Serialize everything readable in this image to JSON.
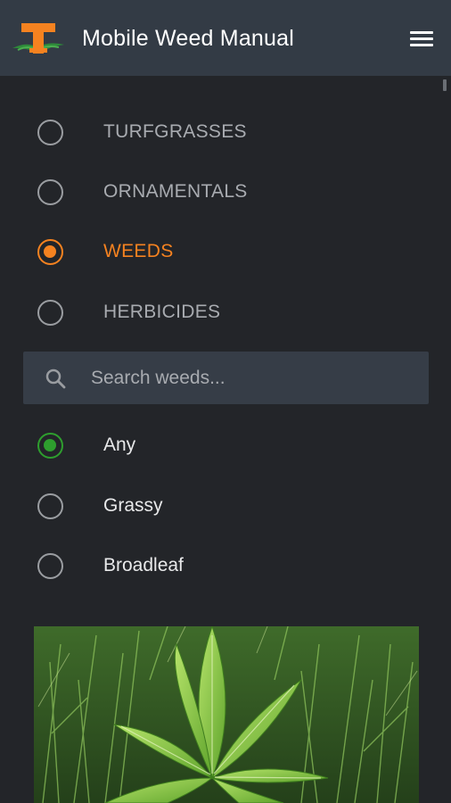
{
  "app": {
    "title": "Mobile Weed Manual",
    "logo_letter": "T",
    "accent_color": "#f58220",
    "filter_color": "#2e9e2e"
  },
  "categories": [
    {
      "label": "TURFGRASSES",
      "selected": false
    },
    {
      "label": "ORNAMENTALS",
      "selected": false
    },
    {
      "label": "WEEDS",
      "selected": true
    },
    {
      "label": "HERBICIDES",
      "selected": false
    }
  ],
  "search": {
    "placeholder": "Search weeds...",
    "value": "",
    "icon": "search-icon"
  },
  "filters": [
    {
      "label": "Any",
      "selected": true
    },
    {
      "label": "Grassy",
      "selected": false
    },
    {
      "label": "Broadleaf",
      "selected": false
    }
  ],
  "menu": {
    "icon": "hamburger-menu-icon"
  }
}
